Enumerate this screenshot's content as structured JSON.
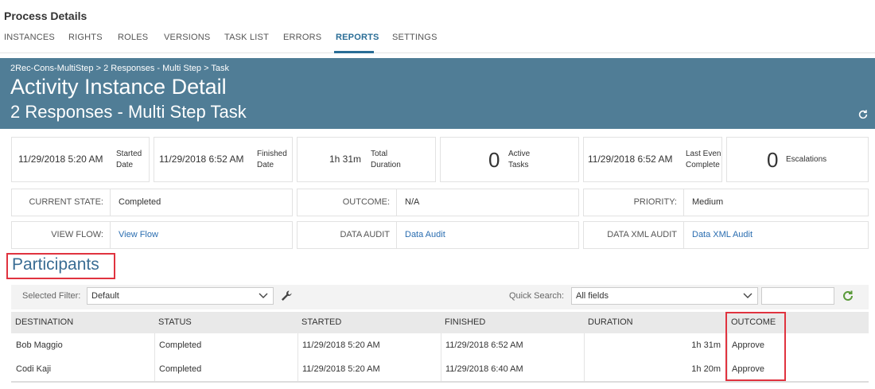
{
  "page_title": "Process Details",
  "tabs": [
    {
      "label": "INSTANCES"
    },
    {
      "label": "RIGHTS"
    },
    {
      "label": "ROLES"
    },
    {
      "label": "VERSIONS"
    },
    {
      "label": "TASK LIST"
    },
    {
      "label": "ERRORS"
    },
    {
      "label": "REPORTS",
      "active": true
    },
    {
      "label": "SETTINGS"
    }
  ],
  "banner": {
    "breadcrumb": [
      "2Rec-Cons-MultiStep",
      ">",
      "2 Responses - Multi Step",
      ">",
      "Task"
    ],
    "title": "Activity Instance Detail",
    "subtitle": "2 Responses - Multi Step Task",
    "color": "#507d96"
  },
  "cards": {
    "started": {
      "value": "11/29/2018 5:20 AM",
      "label1": "Started",
      "label2": "Date"
    },
    "finished": {
      "value": "11/29/2018 6:52 AM",
      "label1": "Finished",
      "label2": "Date"
    },
    "duration": {
      "value": "1h 31m",
      "label1": "Total",
      "label2": "Duration"
    },
    "active": {
      "value": "0",
      "label1": "Active",
      "label2": "Tasks"
    },
    "last": {
      "value": "11/29/2018 6:52 AM",
      "label1": "Last Even",
      "label2": "Complete"
    },
    "escalations": {
      "value": "0",
      "label1": "Escalations"
    }
  },
  "props": {
    "current_state": {
      "label": "CURRENT STATE:",
      "value": "Completed"
    },
    "outcome": {
      "label": "OUTCOME:",
      "value": "N/A"
    },
    "priority": {
      "label": "PRIORITY:",
      "value": "Medium"
    },
    "view_flow": {
      "label": "VIEW FLOW:",
      "value": "View Flow"
    },
    "data_audit": {
      "label": "DATA AUDIT",
      "value": "Data Audit"
    },
    "data_xml_audit": {
      "label": "DATA XML AUDIT",
      "value": "Data XML Audit"
    }
  },
  "participants": {
    "heading": "Participants",
    "filter_label": "Selected Filter:",
    "filter_value": "Default",
    "quick_search_label": "Quick Search:",
    "quick_search_scope": "All fields",
    "search_value": "",
    "columns": [
      "DESTINATION",
      "STATUS",
      "STARTED",
      "FINISHED",
      "DURATION",
      "OUTCOME"
    ],
    "rows": [
      {
        "destination": "Bob Maggio",
        "status": "Completed",
        "started": "11/29/2018 5:20 AM",
        "finished": "11/29/2018 6:52 AM",
        "duration": "1h 31m",
        "outcome": "Approve"
      },
      {
        "destination": "Codi Kaji",
        "status": "Completed",
        "started": "11/29/2018 5:20 AM",
        "finished": "11/29/2018 6:40 AM",
        "duration": "1h 20m",
        "outcome": "Approve"
      }
    ]
  },
  "colors": {
    "accent": "#2a6d96",
    "highlight": "#e0333f",
    "link": "#2a6db0",
    "refresh_green": "#5a9a3a"
  }
}
